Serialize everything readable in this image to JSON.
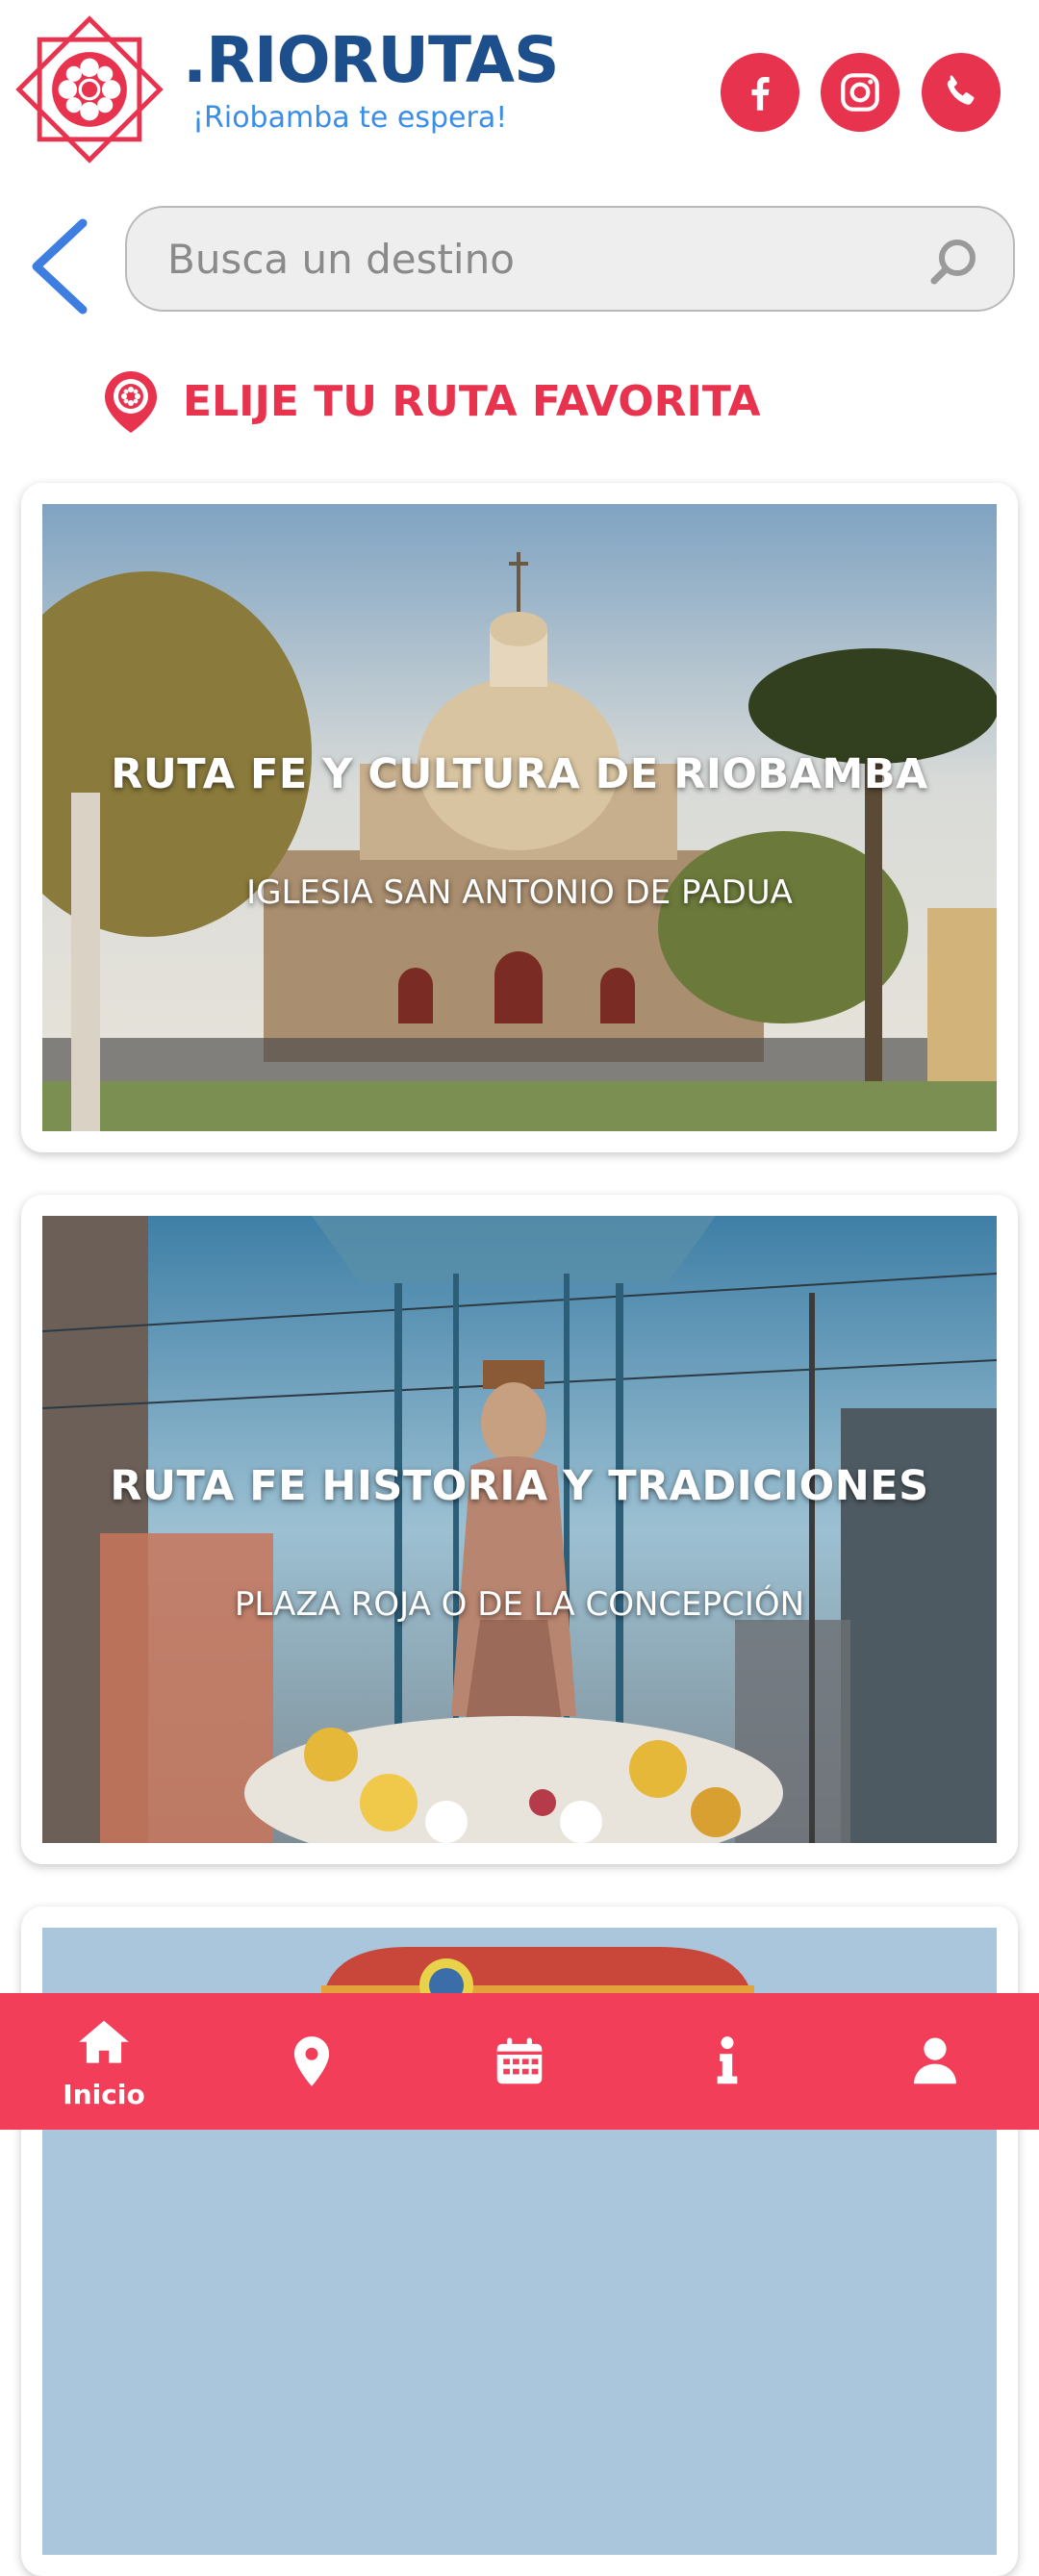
{
  "brand": {
    "name": ".RIORUTAS",
    "tagline": "¡Riobamba te espera!",
    "primary_color": "#e8334f",
    "name_color": "#1d4f8c",
    "tagline_color": "#3a8ee6"
  },
  "social": [
    {
      "icon": "facebook-icon"
    },
    {
      "icon": "instagram-icon"
    },
    {
      "icon": "whatsapp-icon"
    }
  ],
  "search": {
    "placeholder": "Busca un destino",
    "back_icon": "chevron-left-icon",
    "search_icon": "search-icon"
  },
  "section": {
    "title": "ELIJE TU RUTA FAVORITA",
    "icon": "map-pin-icon"
  },
  "routes": [
    {
      "title": "RUTA FE Y CULTURA DE RIOBAMBA",
      "subtitle": "IGLESIA SAN ANTONIO DE PADUA"
    },
    {
      "title": "RUTA FE HISTORIA Y TRADICIONES",
      "subtitle": "PLAZA ROJA O DE LA CONCEPCIÓN"
    },
    {
      "title": "",
      "subtitle": ""
    }
  ],
  "bottom_nav": {
    "items": [
      {
        "icon": "home-icon",
        "label": "Inicio",
        "active": true
      },
      {
        "icon": "location-icon",
        "label": ""
      },
      {
        "icon": "calendar-icon",
        "label": ""
      },
      {
        "icon": "info-icon",
        "label": ""
      },
      {
        "icon": "user-icon",
        "label": ""
      }
    ],
    "background": "#f23e58"
  }
}
